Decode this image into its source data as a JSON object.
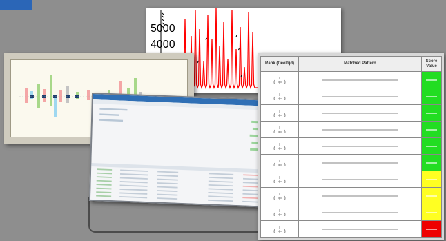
{
  "colors": {
    "background": "#8e8e8e",
    "accent": "#2b66b7",
    "spectrum_line": "#ff0000",
    "score_green": "#22dd22",
    "score_yellow": "#ffff22",
    "score_red": "#ee0000"
  },
  "spectrum": {
    "y_ticks": [
      "5000",
      "4000"
    ]
  },
  "table": {
    "headers": {
      "rank": "Rank (Deeltijd)",
      "pattern": "Matched Pattern",
      "score": "Score Value"
    },
    "rows": [
      {
        "score_level": "green"
      },
      {
        "score_level": "green"
      },
      {
        "score_level": "green"
      },
      {
        "score_level": "green"
      },
      {
        "score_level": "green"
      },
      {
        "score_level": "green"
      },
      {
        "score_level": "yellow"
      },
      {
        "score_level": "yellow"
      },
      {
        "score_level": "yellow"
      },
      {
        "score_level": "red"
      }
    ]
  }
}
